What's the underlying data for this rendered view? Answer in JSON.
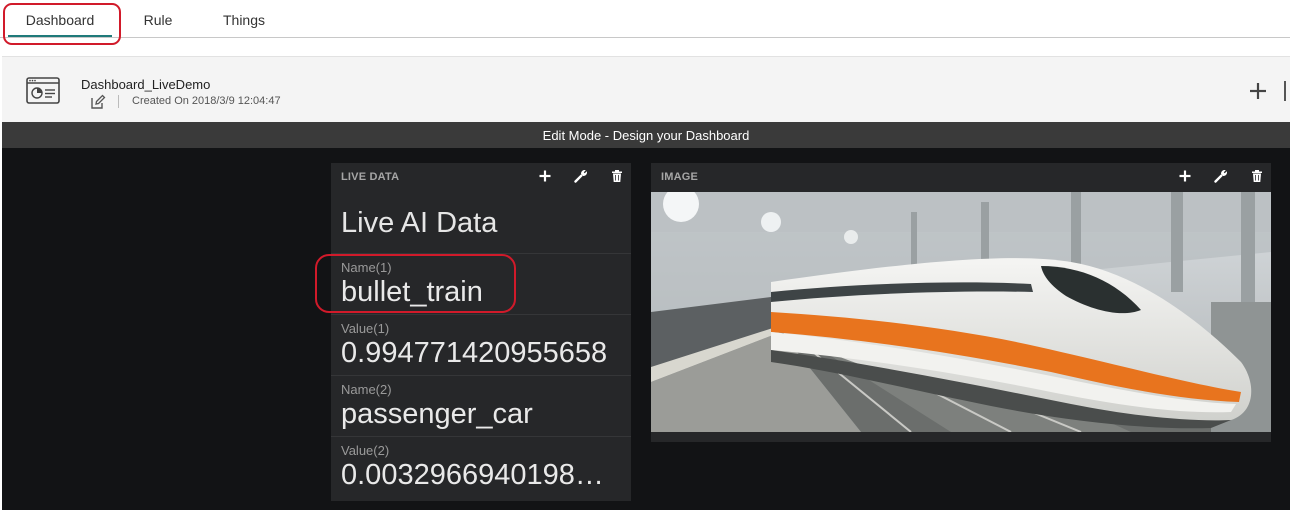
{
  "tabs": [
    {
      "label": "Dashboard"
    },
    {
      "label": "Rule"
    },
    {
      "label": "Things"
    }
  ],
  "header": {
    "dashboard_name": "Dashboard_LiveDemo",
    "created_label": "Created On",
    "created_value": "2018/3/9 12:04:47"
  },
  "modebar": {
    "text": "Edit Mode - Design your Dashboard"
  },
  "widgets": {
    "live": {
      "title": "LIVE DATA",
      "heading": "Live AI Data",
      "rows": [
        {
          "label": "Name(1)",
          "value": "bullet_train"
        },
        {
          "label": "Value(1)",
          "value": "0.994771420955658"
        },
        {
          "label": "Name(2)",
          "value": "passenger_car"
        },
        {
          "label": "Value(2)",
          "value": "0.0032966940198…"
        }
      ]
    },
    "image": {
      "title": "IMAGE"
    }
  },
  "icons": {
    "add": "plus-icon",
    "settings": "wrench-icon",
    "delete": "trash-icon",
    "edit": "edit-icon",
    "dashboard": "dashboard-icon"
  },
  "colors": {
    "tab_underline": "#1f7a7a",
    "annotation": "#d11a2a",
    "canvas": "#121315",
    "widget": "#262729",
    "train_orange": "#e8741e"
  }
}
